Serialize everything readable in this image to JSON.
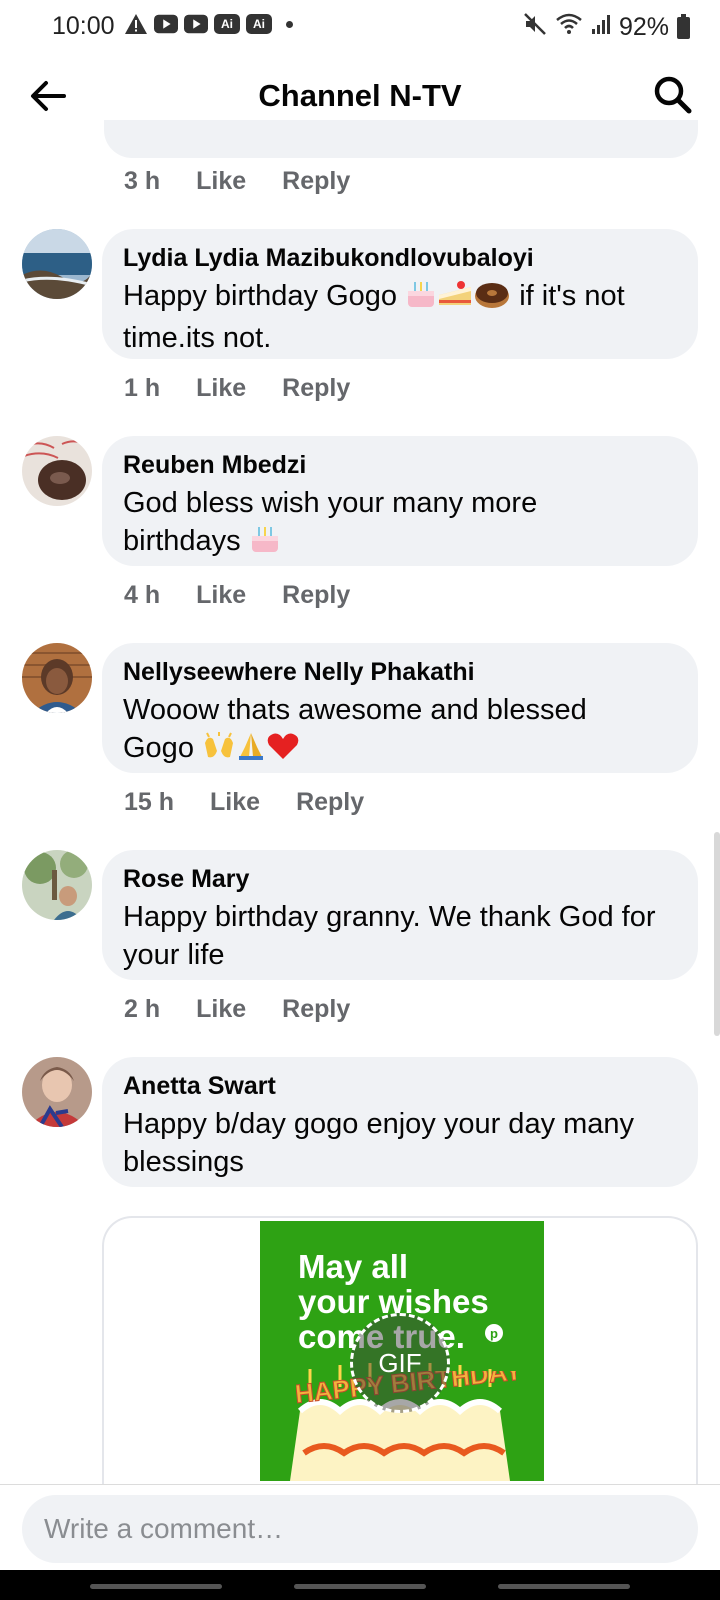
{
  "status_bar": {
    "time": "10:00",
    "app_badge_1": "Ai",
    "app_badge_2": "Ai",
    "battery": "92%"
  },
  "header": {
    "title": "Channel N-TV"
  },
  "previous_comment": {
    "time": "3 h",
    "like_label": "Like",
    "reply_label": "Reply"
  },
  "comments": [
    {
      "author": "Lydia Lydia Mazibukondlovubaloyi",
      "text_line1": "Happy birthday Gogo",
      "text_line1_tail": "if it's not",
      "text_line2": "time.its not.",
      "time": "1 h",
      "like_label": "Like",
      "reply_label": "Reply"
    },
    {
      "author": "Reuben Mbedzi",
      "text_line1": "God bless wish your many more",
      "text_line2": "birthdays",
      "time": "4 h",
      "like_label": "Like",
      "reply_label": "Reply"
    },
    {
      "author": "Nellyseewhere Nelly Phakathi",
      "text_line1": "Wooow thats awesome and blessed",
      "text_line2": "Gogo",
      "time": "15 h",
      "like_label": "Like",
      "reply_label": "Reply"
    },
    {
      "author": "Rose Mary",
      "text_line1": "Happy birthday granny. We thank God for",
      "text_line2": "your life",
      "time": "2 h",
      "like_label": "Like",
      "reply_label": "Reply"
    },
    {
      "author": "Anetta Swart",
      "text_line1": "Happy b/day gogo enjoy your day many",
      "text_line2": "blessings"
    }
  ],
  "gif": {
    "line1": "May all",
    "line2": "your wishes",
    "line3": "come true.",
    "badge": "GIF",
    "banner": "HAPPY BIRTHDAY"
  },
  "composer": {
    "placeholder": "Write a comment…"
  },
  "colors": {
    "bubble": "#f0f2f5",
    "meta_text": "#65676b",
    "gif_green": "#2ea214"
  }
}
